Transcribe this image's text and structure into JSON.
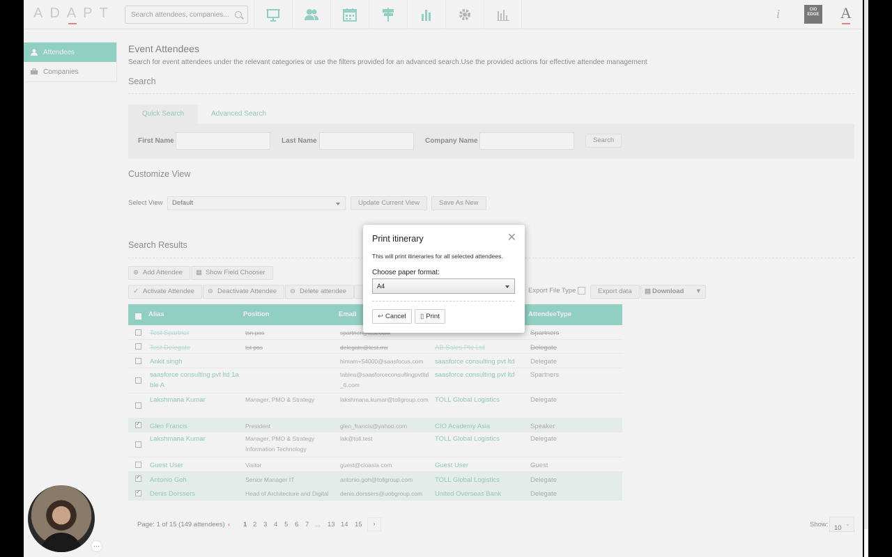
{
  "app": {
    "logo_text": "ADAPT",
    "search_placeholder": "Search attendees, companies...",
    "cio_logo_text": "CIO EDGE",
    "nav_icons": [
      "presentation-icon",
      "users-icon",
      "calendar-icon",
      "signpost-icon",
      "bar-chart-icon",
      "gear-icon",
      "analytics-icon"
    ]
  },
  "sidebar": {
    "items": [
      {
        "label": "Attendees",
        "icon": "user-icon",
        "active": true
      },
      {
        "label": "Companies",
        "icon": "briefcase-icon",
        "active": false
      }
    ]
  },
  "header": {
    "title": "Event Attendees",
    "description": "Search for event attendees under the relevant categories or use the filters provided for an advanced search.Use the provided actions for effective attendee management"
  },
  "search": {
    "heading": "Search",
    "tabs": [
      "Quick Search",
      "Advanced Search"
    ],
    "first_name_label": "First Name",
    "last_name_label": "Last Name",
    "company_name_label": "Company Name",
    "search_button": "Search"
  },
  "customize": {
    "heading": "Customize View",
    "select_view_label": "Select View",
    "select_view_value": "Default",
    "update_button": "Update Current View",
    "save_button": "Save As New"
  },
  "results": {
    "heading": "Search Results",
    "add_attendee": "Add Attendee",
    "show_field_chooser": "Show Field Chooser",
    "activate": "Activate Attendee",
    "deactivate": "Deactivate Attendee",
    "delete": "Delete attendee",
    "export_file_type": "Export File Type",
    "export_data": "Export data",
    "download": "Download",
    "columns": [
      "Alias",
      "Position",
      "Email",
      "",
      "AttendeeType"
    ],
    "rows": [
      {
        "alias": "Test Spartner",
        "position": "tsn.pos",
        "email": "spartner@test.com",
        "company": "",
        "type": "Spartners",
        "struck": true,
        "checked": false
      },
      {
        "alias": "Test Delegate",
        "position": "tst pos",
        "email": "delegate@test.mx",
        "company": "AB Sales Pte Ltd",
        "type": "Delegate",
        "struck": true,
        "checked": false
      },
      {
        "alias": "Ankit singh",
        "position": "",
        "email": "himam+54000@saasfocus.com",
        "company": "saasforce consulting pvt ltd",
        "type": "Delegate",
        "struck": false,
        "checked": false
      },
      {
        "alias": "saasforce consulting pvt ltd 1a ble A",
        "position": "",
        "email": "tablea@saasforceconsultingpvtltd_6.com",
        "company": "saasforce consulting pvt ltd",
        "type": "Spartners",
        "struck": false,
        "checked": false
      },
      {
        "alias": "Lakshmana Kumar",
        "position": "Manager, PMO & Strategy",
        "email": "lakshmana.kumar@tollgroup.com",
        "company": "TOLL Global Logistics",
        "type": "Delegate",
        "struck": false,
        "checked": false
      },
      {
        "alias": "Glen Francis",
        "position": "President",
        "email": "glen_francis@yahoo.com",
        "company": "CIO Academy Asia",
        "type": "Speaker",
        "struck": false,
        "checked": true
      },
      {
        "alias": "Lakshmana Kumar",
        "position": "Manager, PMO & Strategy Information Technology",
        "email": "lak@toll.test",
        "company": "TOLL Global Logistics",
        "type": "Delegate",
        "struck": false,
        "checked": false
      },
      {
        "alias": "Guest User",
        "position": "Visitor",
        "email": "guest@cioasia.com",
        "company": "Guest User",
        "type": "Guest",
        "struck": false,
        "checked": false
      },
      {
        "alias": "Antonio Goh",
        "position": "Senior Manager IT",
        "email": "antonio.goh@tollgroup.com",
        "company": "TOLL Global Logistics",
        "type": "Delegate",
        "struck": false,
        "checked": true
      },
      {
        "alias": "Denis Dorssers",
        "position": "Head of Architecture and Digital",
        "email": "denis.dorssers@uobgroup.com",
        "company": "United Overseas Bank",
        "type": "Delegate",
        "struck": false,
        "checked": true
      }
    ]
  },
  "pagination": {
    "summary": "Page: 1 of 15 (149 attendees)",
    "pages": [
      "1",
      "2",
      "3",
      "4",
      "5",
      "6",
      "7",
      "...",
      "13",
      "14",
      "15"
    ],
    "show_label": "Show:",
    "show_value": "10"
  },
  "modal": {
    "title": "Print itinerary",
    "text": "This will print itineraries for all selected attendees.",
    "label": "Choose paper format:",
    "format_value": "A4",
    "cancel": "Cancel",
    "print": "Print"
  },
  "colors": {
    "accent": "#5fc6b1",
    "link": "#5fb8a8",
    "brand_red": "#d94a4a"
  }
}
